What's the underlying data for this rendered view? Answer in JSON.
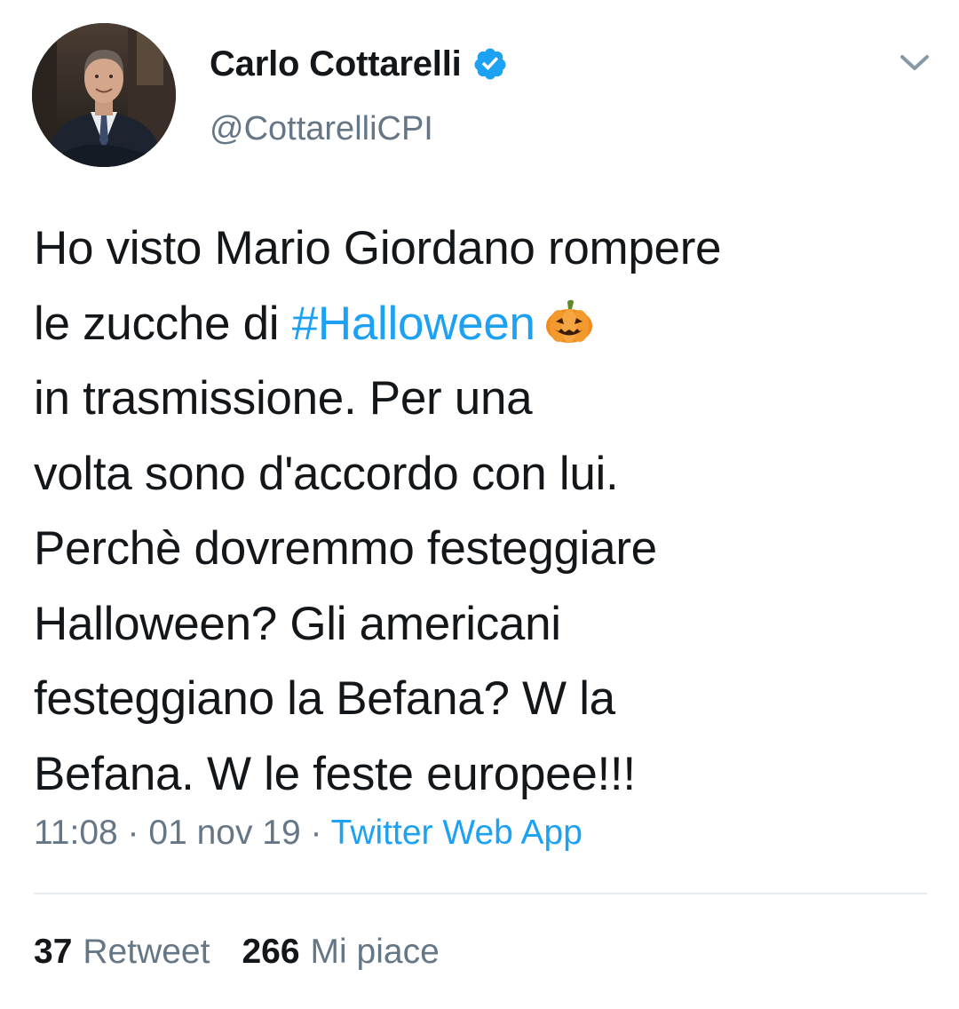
{
  "author": {
    "display_name": "Carlo Cottarelli",
    "handle": "@CottarelliCPI",
    "verified_icon": "verified-badge-icon",
    "avatar": "profile-photo"
  },
  "menu_icon": "chevron-down-icon",
  "tweet": {
    "lines": [
      {
        "text": "Ho visto Mario Giordano rompere"
      },
      {
        "prefix": "le zucche di ",
        "hashtag": "#Halloween",
        "emoji": "pumpkin-emoji"
      },
      {
        "text": "in trasmissione. Per una"
      },
      {
        "text": "volta sono d'accordo con lui."
      },
      {
        "text": "Perchè dovremmo festeggiare"
      },
      {
        "text": "Halloween? Gli americani"
      },
      {
        "text": "festeggiano la Befana? W la"
      },
      {
        "text": "Befana. W le feste europee!!!"
      }
    ]
  },
  "meta": {
    "time": "11:08",
    "separator": " · ",
    "date": "01 nov 19",
    "source": "Twitter Web App"
  },
  "stats": {
    "retweets_count": "37",
    "retweets_label": "Retweet",
    "likes_count": "266",
    "likes_label": "Mi piace"
  },
  "colors": {
    "link": "#1da1f2",
    "secondary_text": "#657786",
    "primary_text": "#14171a",
    "divider": "#e6ecf0"
  }
}
